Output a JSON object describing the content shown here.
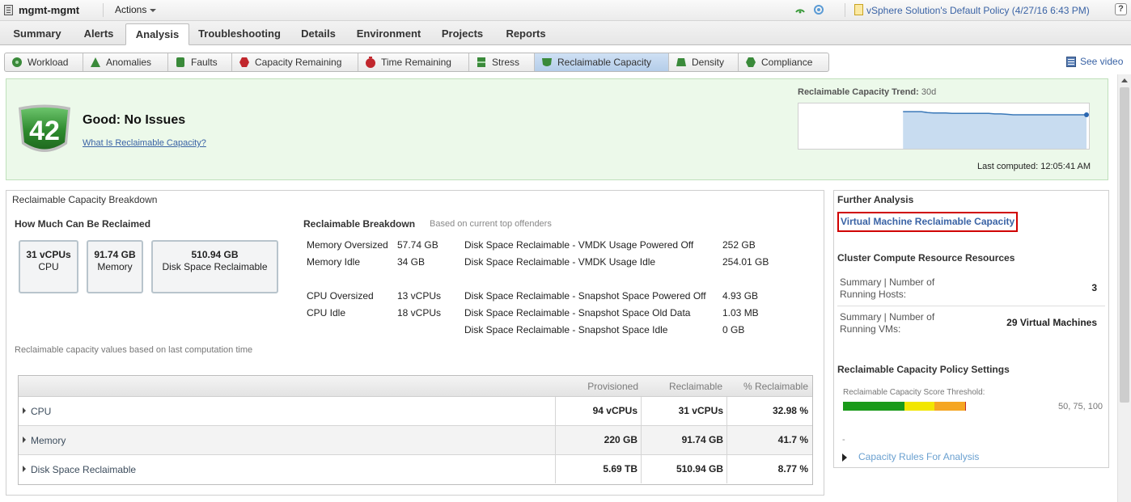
{
  "header": {
    "object_name": "mgmt-mgmt",
    "actions_label": "Actions",
    "policy_label": "vSphere Solution's Default Policy (4/27/16 6:43 PM)",
    "help_label": "?"
  },
  "main_tabs": [
    {
      "label": "Summary"
    },
    {
      "label": "Alerts"
    },
    {
      "label": "Analysis",
      "active": true
    },
    {
      "label": "Troubleshooting"
    },
    {
      "label": "Details"
    },
    {
      "label": "Environment"
    },
    {
      "label": "Projects"
    },
    {
      "label": "Reports"
    }
  ],
  "sub_tabs": [
    {
      "label": "Workload",
      "icon": "gear-badge-icon",
      "color": "#3a8a3a"
    },
    {
      "label": "Anomalies",
      "icon": "triangle-badge-icon",
      "color": "#3a8a3a"
    },
    {
      "label": "Faults",
      "icon": "fault-badge-icon",
      "color": "#3a8a3a"
    },
    {
      "label": "Capacity Remaining",
      "icon": "hexagon-badge-icon",
      "color": "#c1272d"
    },
    {
      "label": "Time Remaining",
      "icon": "clock-badge-icon",
      "color": "#c1272d"
    },
    {
      "label": "Stress",
      "icon": "stress-badge-icon",
      "color": "#3a8a3a"
    },
    {
      "label": "Reclaimable Capacity",
      "icon": "shield-badge-icon",
      "color": "#3a8a3a",
      "active": true
    },
    {
      "label": "Density",
      "icon": "density-badge-icon",
      "color": "#3a8a3a"
    },
    {
      "label": "Compliance",
      "icon": "compliance-badge-icon",
      "color": "#3a8a3a"
    }
  ],
  "see_video_label": "See video",
  "status": {
    "score": "42",
    "title": "Good: No Issues",
    "link": "What Is Reclaimable Capacity?",
    "trend_title": "Reclaimable Capacity Trend:",
    "trend_period": "30d",
    "last_computed": "Last computed: 12:05:41 AM",
    "badge_color": "#3b8a3b"
  },
  "trend_data": {
    "values": [
      0.82,
      0.82,
      0.82,
      0.82,
      0.8,
      0.79,
      0.79,
      0.79,
      0.78,
      0.78,
      0.78,
      0.78,
      0.78,
      0.78,
      0.78,
      0.77,
      0.77,
      0.76,
      0.75,
      0.75,
      0.75,
      0.75,
      0.75,
      0.75,
      0.75,
      0.75,
      0.75,
      0.75,
      0.75,
      0.75,
      0.75
    ],
    "start_fraction": 0.36
  },
  "breakdown": {
    "title": "Reclaimable Capacity Breakdown",
    "how_much_title": "How Much Can Be Reclaimed",
    "boxes": [
      {
        "value": "31 vCPUs",
        "label": "CPU"
      },
      {
        "value": "91.74 GB",
        "label": "Memory"
      },
      {
        "value": "510.94 GB",
        "label": "Disk Space Reclaimable"
      }
    ],
    "rb_title": "Reclaimable Breakdown",
    "rb_subtitle": "Based on current top offenders",
    "left_items": [
      {
        "label": "Memory Oversized",
        "value": "57.74 GB"
      },
      {
        "label": "Memory Idle",
        "value": "34 GB"
      },
      {
        "label": "CPU Oversized",
        "value": "13 vCPUs"
      },
      {
        "label": "CPU Idle",
        "value": "18 vCPUs"
      }
    ],
    "right_items": [
      {
        "label": "Disk Space Reclaimable - VMDK Usage Powered Off",
        "value": "252 GB"
      },
      {
        "label": "Disk Space Reclaimable - VMDK Usage Idle",
        "value": "254.01 GB"
      },
      {
        "label": "Disk Space Reclaimable - Snapshot Space Powered Off",
        "value": "4.93 GB"
      },
      {
        "label": "Disk Space Reclaimable - Snapshot Space Old Data",
        "value": "1.03 MB"
      },
      {
        "label": "Disk Space Reclaimable - Snapshot Space Idle",
        "value": "0 GB"
      }
    ],
    "note": "Reclaimable capacity values based on last computation time"
  },
  "table": {
    "headers": [
      "Provisioned",
      "Reclaimable",
      "% Reclaimable"
    ],
    "rows": [
      {
        "name": "CPU",
        "provisioned": "94 vCPUs",
        "reclaimable": "31 vCPUs",
        "percent": "32.98 %"
      },
      {
        "name": "Memory",
        "provisioned": "220 GB",
        "reclaimable": "91.74 GB",
        "percent": "41.7 %"
      },
      {
        "name": "Disk Space Reclaimable",
        "provisioned": "5.69 TB",
        "reclaimable": "510.94 GB",
        "percent": "8.77 %"
      }
    ]
  },
  "further": {
    "title": "Further Analysis",
    "vm_link": "Virtual Machine Reclaimable Capacity",
    "cluster_title": "Cluster Compute Resource Resources",
    "summaries": [
      {
        "label1": "Summary | Number of",
        "label2": "Running Hosts:",
        "value": "3"
      },
      {
        "label1": "Summary | Number of",
        "label2": "Running VMs:",
        "value": "29 Virtual Machines"
      }
    ],
    "policy_title": "Reclaimable Capacity Policy Settings",
    "threshold_label": "Reclaimable Capacity Score Threshold:",
    "threshold_values": "50, 75, 100",
    "threshold_segments": [
      {
        "color": "#1a9a1a",
        "fraction": 0.5
      },
      {
        "color": "#f2e600",
        "fraction": 0.25
      },
      {
        "color": "#f5a623",
        "fraction": 0.25
      }
    ],
    "dash": "-",
    "rules_link": "Capacity Rules For Analysis"
  }
}
